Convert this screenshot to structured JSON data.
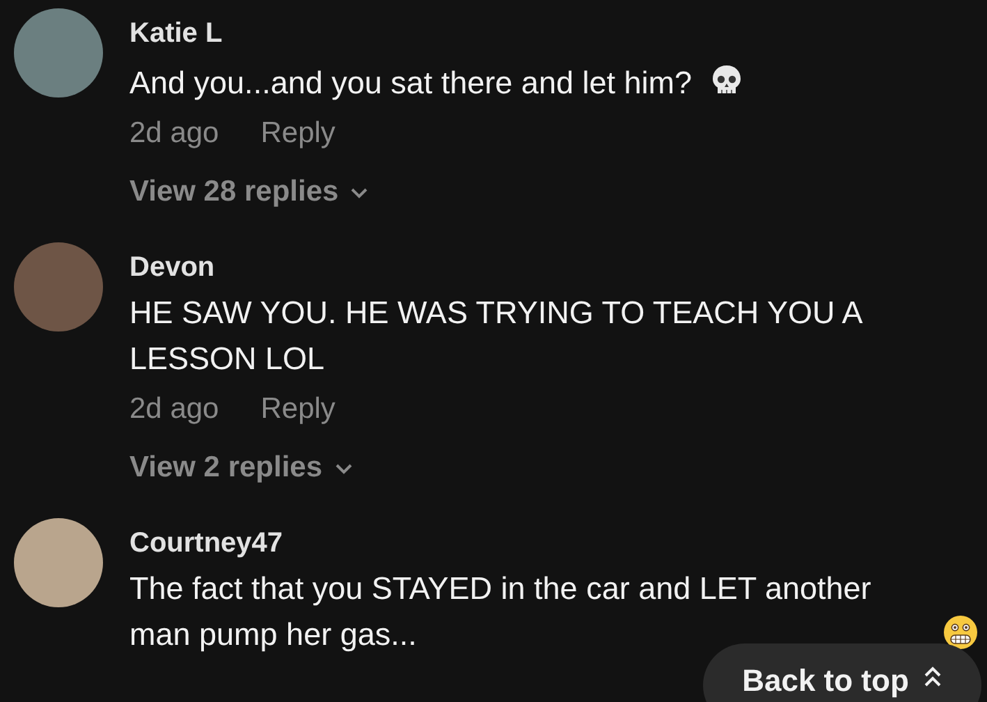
{
  "comments": [
    {
      "author": "Katie L",
      "text": "And you...and you sat there and let him?",
      "emoji_icon": {
        "kind": "skull"
      },
      "time": "2d ago",
      "reply": "Reply",
      "view_replies": "View 28 replies"
    },
    {
      "author": "Devon",
      "text": "HE SAW YOU. HE WAS TRYING TO TEACH YOU A LESSON LOL",
      "time": "2d ago",
      "reply": "Reply",
      "view_replies": "View 2 replies"
    },
    {
      "author": "Courtney47",
      "text": "The fact that you STAYED in the car and LET another man pump her gas...",
      "emoji_icon": {
        "kind": "grimace"
      }
    }
  ],
  "back_to_top": "Back to top"
}
